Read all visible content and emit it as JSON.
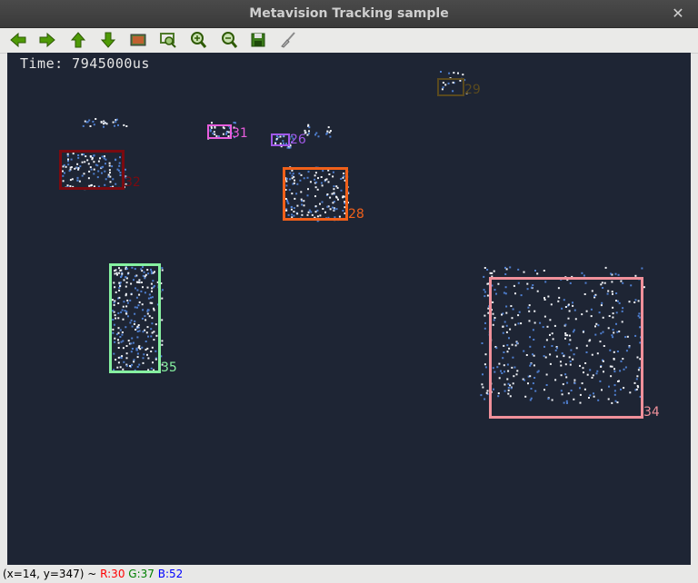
{
  "window": {
    "title": "Metavision Tracking sample",
    "close_glyph": "✕"
  },
  "toolbar": {
    "buttons": [
      {
        "name": "arrow-left-icon"
      },
      {
        "name": "arrow-right-icon"
      },
      {
        "name": "arrow-up-icon"
      },
      {
        "name": "arrow-down-icon"
      },
      {
        "name": "image-icon"
      },
      {
        "name": "zoom-region-icon"
      },
      {
        "name": "zoom-in-icon"
      },
      {
        "name": "zoom-out-icon"
      },
      {
        "name": "save-icon"
      },
      {
        "name": "brush-icon"
      }
    ]
  },
  "view": {
    "time_text": "Time: 7945000us",
    "tracks": [
      {
        "id": "29",
        "color": "#5a4a1e"
      },
      {
        "id": "31",
        "color": "#e85ddc"
      },
      {
        "id": "26",
        "color": "#a259e8"
      },
      {
        "id": "32",
        "color": "#7a0a10"
      },
      {
        "id": "28",
        "color": "#f0601a"
      },
      {
        "id": "35",
        "color": "#86f0a0"
      },
      {
        "id": "34",
        "color": "#f0909a"
      }
    ]
  },
  "status": {
    "coords": "(x=14, y=347) ~ ",
    "r": "R:30",
    "g": "G:37",
    "b": "B:52",
    "r_color": "#ff0000",
    "g_color": "#008000",
    "b_color": "#0000ff"
  }
}
